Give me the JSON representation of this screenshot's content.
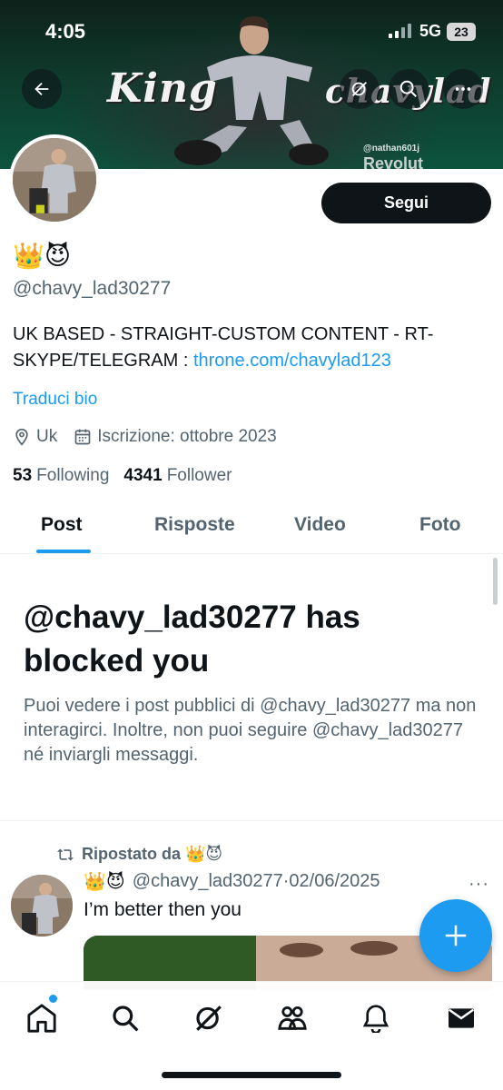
{
  "status_bar": {
    "time": "4:05",
    "network": "5G",
    "battery": "23"
  },
  "banner": {
    "title_left": "King",
    "title_right": "chavylad",
    "watermark_handle": "@nathan601j",
    "watermark_brand": "Revolut"
  },
  "profile": {
    "display_name": "👑😈",
    "handle": "@chavy_lad30277",
    "follow_label": "Segui",
    "bio_text": "UK BASED - STRAIGHT-CUSTOM CONTENT - RT-SKYPE/TELEGRAM : ",
    "bio_link": "throne.com/chavylad123",
    "translate_label": "Traduci bio",
    "location": "Uk",
    "joined": "Iscrizione: ottobre 2023",
    "following_count": "53",
    "following_label": "Following",
    "followers_count": "4341",
    "followers_label": "Follower"
  },
  "tabs": [
    {
      "label": "Post",
      "active": true
    },
    {
      "label": "Risposte",
      "active": false
    },
    {
      "label": "Video",
      "active": false
    },
    {
      "label": "Foto",
      "active": false
    }
  ],
  "blocked": {
    "title": "@chavy_lad30277 has blocked you",
    "description": "Puoi vedere i post pubblici di @chavy_lad30277 ma non interagirci. Inoltre, non puoi seguire @chavy_lad30277 né inviargli messaggi."
  },
  "post": {
    "repost_label": "Ripostato da 👑😈",
    "author_emoji": "👑😈",
    "author_handle": "@chavy_lad30277",
    "separator": "·",
    "date": "02/06/2025",
    "text": "I’m better then you",
    "more": "···"
  },
  "colors": {
    "accent": "#1d9bf0",
    "text_primary": "#0f1419",
    "text_secondary": "#536471",
    "follow_button": "#0f1419"
  },
  "icons": {
    "back": "arrow-left-icon",
    "grok": "grok-icon",
    "search": "search-icon",
    "more": "more-icon",
    "location": "location-pin-icon",
    "calendar": "calendar-icon",
    "repost": "repost-icon",
    "compose": "plus-icon",
    "nav": [
      "home-icon",
      "search-icon",
      "grok-icon",
      "communities-icon",
      "bell-icon",
      "mail-icon"
    ]
  }
}
